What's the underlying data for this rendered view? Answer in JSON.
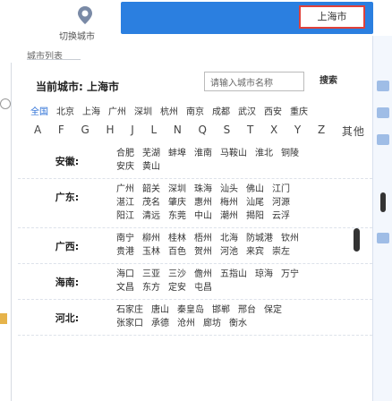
{
  "header": {
    "switch_label": "切换城市",
    "list_title": "城市列表",
    "selected_city": "上海市"
  },
  "current": {
    "label": "当前城市: 上海市"
  },
  "search": {
    "placeholder": "请输入城市名称",
    "button_label": "搜索"
  },
  "hot_cities": [
    "全国",
    "北京",
    "上海",
    "广州",
    "深圳",
    "杭州",
    "南京",
    "成都",
    "武汉",
    "西安",
    "重庆"
  ],
  "alphabet": [
    "A",
    "F",
    "G",
    "H",
    "J",
    "L",
    "N",
    "Q",
    "S",
    "T",
    "X",
    "Y",
    "Z",
    "其他"
  ],
  "provinces": [
    {
      "label": "安徽:",
      "rows": [
        [
          "合肥",
          "芜湖",
          "蚌埠",
          "淮南",
          "马鞍山",
          "淮北",
          "铜陵"
        ],
        [
          "安庆",
          "黄山"
        ]
      ]
    },
    {
      "label": "广东:",
      "rows": [
        [
          "广州",
          "韶关",
          "深圳",
          "珠海",
          "汕头",
          "佛山",
          "江门"
        ],
        [
          "湛江",
          "茂名",
          "肇庆",
          "惠州",
          "梅州",
          "汕尾",
          "河源"
        ],
        [
          "阳江",
          "清远",
          "东莞",
          "中山",
          "潮州",
          "揭阳",
          "云浮"
        ]
      ]
    },
    {
      "label": "广西:",
      "rows": [
        [
          "南宁",
          "柳州",
          "桂林",
          "梧州",
          "北海",
          "防城港",
          "钦州"
        ],
        [
          "贵港",
          "玉林",
          "百色",
          "贺州",
          "河池",
          "来宾",
          "崇左"
        ]
      ]
    },
    {
      "label": "海南:",
      "rows": [
        [
          "海口",
          "三亚",
          "三沙",
          "儋州",
          "五指山",
          "琼海",
          "万宁"
        ],
        [
          "文昌",
          "东方",
          "定安",
          "屯昌"
        ]
      ]
    },
    {
      "label": "河北:",
      "rows": [
        [
          "石家庄",
          "唐山",
          "秦皇岛",
          "邯郸",
          "邢台",
          "保定"
        ],
        [
          "张家口",
          "承德",
          "沧州",
          "廊坊",
          "衡水"
        ]
      ]
    }
  ],
  "colors": {
    "accent": "#2b7fe0",
    "highlight_border": "#e0413a"
  },
  "icons": {
    "pin": "location-pin-icon"
  }
}
